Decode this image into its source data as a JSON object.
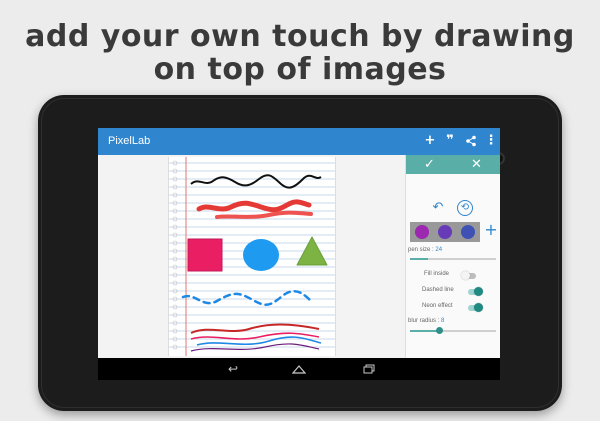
{
  "headline": {
    "line1": "add your own touch by drawing",
    "line2": "on top of images"
  },
  "app": {
    "title": "PixelLab",
    "actions": [
      {
        "name": "add-icon",
        "glyph": "+"
      },
      {
        "name": "quote-icon",
        "glyph": "❞"
      },
      {
        "name": "share-icon",
        "glyph": "<"
      },
      {
        "name": "more-vert-icon",
        "glyph": "⋮"
      }
    ]
  },
  "panel": {
    "confirm_glyph": "✓",
    "close_glyph": "✕",
    "undo_glyph": "↶",
    "reset_glyph": "⟲",
    "add_color_glyph": "+",
    "swatch_colors": [
      "#9c27b0",
      "#673ab7",
      "#3f51b5"
    ],
    "pen_size_label": "pen size :",
    "pen_size_value": "24",
    "fill_inside_label": "Fill inside",
    "fill_inside_on": false,
    "dashed_line_label": "Dashed line",
    "dashed_line_on": true,
    "neon_effect_label": "Neon effect",
    "neon_effect_on": true,
    "blur_radius_label": "blur radius :",
    "blur_radius_value": "8"
  },
  "nav": {
    "back_glyph": "↩",
    "home_glyph": "⌂",
    "recents_glyph": "▭"
  },
  "colors": {
    "appbar": "#2f86cf",
    "panel_header": "#5aaea8",
    "accent": "#2f86cf"
  }
}
